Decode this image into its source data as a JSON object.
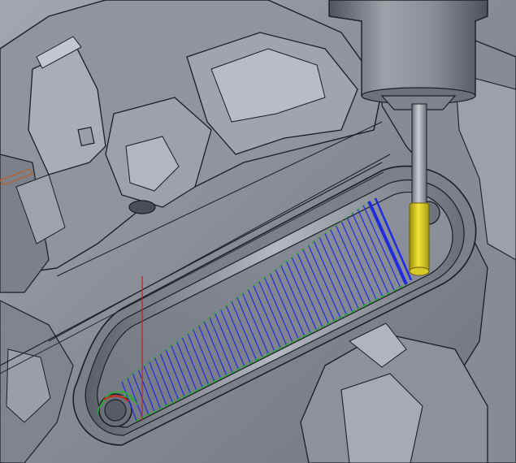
{
  "viewport": {
    "view_type": "cam-toolpath-simulation",
    "colors": {
      "background": "#5f636e",
      "part_surface": "#8e939d",
      "part_highlight": "#b7bbc4",
      "part_shadow": "#3f434c",
      "edge_line": "#1c1e23",
      "toolpath_blue": "#1f2be0",
      "toolpath_green": "#2fa83a",
      "lead_red": "#d21f1f",
      "tool_flute": "#e3d21c",
      "tool_shank": "#9ea1a8",
      "spindle_holder": "#7b7e86",
      "boundary_orange": "#b8612b"
    },
    "icons": {
      "tool": "end-mill-icon",
      "spindle": "tool-holder-icon"
    },
    "toolpath": {
      "strategy": "raster-zigzag",
      "pass_count": 46
    }
  }
}
